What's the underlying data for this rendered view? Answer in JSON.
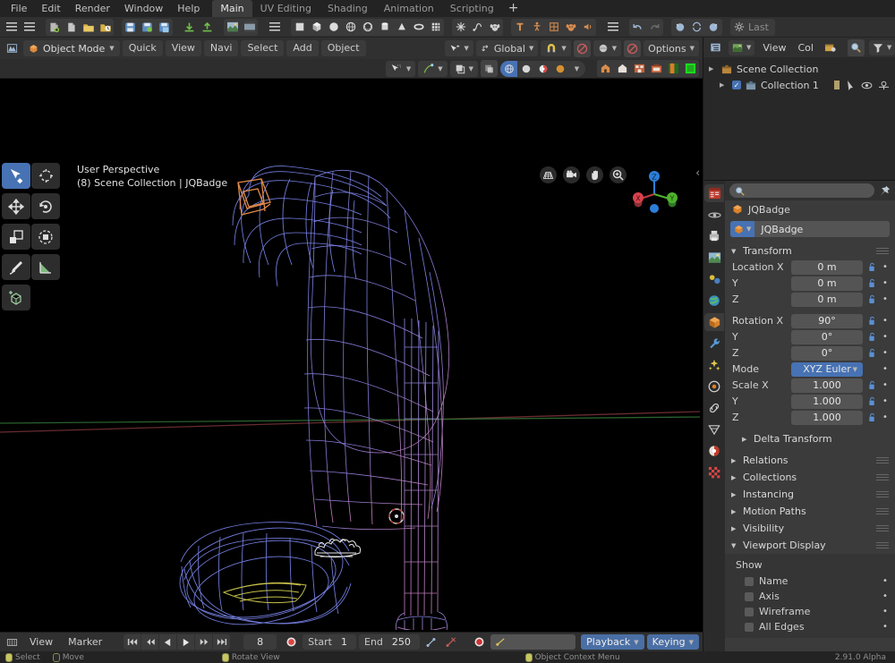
{
  "app": {
    "version": "2.91.0 Alpha"
  },
  "topbar": {
    "menus": [
      "File",
      "Edit",
      "Render",
      "Window",
      "Help"
    ],
    "workspaces": [
      {
        "label": "Main",
        "active": true
      },
      {
        "label": "UV Editing",
        "active": false
      },
      {
        "label": "Shading",
        "active": false
      },
      {
        "label": "Animation",
        "active": false
      },
      {
        "label": "Scripting",
        "active": false
      }
    ],
    "add_workspace": "+"
  },
  "toolbar": {
    "icons": [
      "hamburger-menu-icon",
      "editor-type-icon",
      "new-file-icon",
      "blank-file-icon",
      "open-folder-icon",
      "recent-folder-icon",
      "save-file-icon",
      "save-as-icon",
      "save-copy-icon",
      "import-icon",
      "export-icon",
      "render-image-icon",
      "render-animation-icon"
    ],
    "primitive_icons": [
      "plane-icon",
      "cube-icon",
      "sphere-icon",
      "uvsphere-icon",
      "icosphere-icon",
      "cylinder-icon",
      "cone-icon",
      "torus-icon",
      "grid-icon"
    ],
    "extra_icons": [
      "empty-axis-icon",
      "curve-icon",
      "monkey-icon"
    ],
    "orange_icons": [
      "text-icon",
      "armature-icon",
      "lattice-icon",
      "monkey-head-icon",
      "speaker-icon"
    ],
    "undo_label": "undo-icon",
    "redo_label": "redo-icon",
    "last_label": "Last"
  },
  "viewport_header": {
    "mode": "Object Mode",
    "menus": [
      "Quick",
      "View",
      "Navi",
      "Select",
      "Add",
      "Object"
    ],
    "transform_orientation": "Global",
    "snap_icon": "magnet-icon",
    "proportional_icon": "proportional-editing-icon",
    "options_label": "Options",
    "select_mode_icon": "tweak-select-icon",
    "shading_modes": [
      "wireframe",
      "solid",
      "material-preview",
      "rendered"
    ],
    "overlay_toggles": [
      "show-gizmo-icon",
      "show-overlays-icon",
      "xray-toggle-icon",
      "viewport-shading-icon"
    ]
  },
  "viewport": {
    "perspective_label": "User Perspective",
    "scene_label": "(8) Scene Collection | JQBadge",
    "tools": [
      "tweak-tool",
      "cursor-tool",
      "move-tool",
      "rotate-tool",
      "scale-tool",
      "transform-tool",
      "annotate-tool",
      "measure-tool",
      "add-cube-tool"
    ],
    "nav_icons": [
      "toggle-camera-grid-icon",
      "camera-view-icon",
      "pan-view-icon",
      "zoom-view-icon"
    ],
    "gizmo_axes": [
      {
        "label": "X",
        "color": "#d9434e"
      },
      {
        "label": "Y",
        "color": "#4eb32c"
      },
      {
        "label": "Z",
        "color": "#2c7fd9"
      }
    ],
    "wire_colors": {
      "mesh_blue": "#6a78e8",
      "mesh_pink": "#d07fb8",
      "selected_orange": "#e08a4a",
      "sole_yellow": "#c5c04a",
      "x_axis": "#7a2f35",
      "y_axis": "#2f6b33"
    }
  },
  "outliner": {
    "header_items": [
      "editor-type-icon",
      "display-mode-icon",
      "View",
      "Col",
      "new-collection-icon",
      "filter-search-icon",
      "filter-icon"
    ],
    "rows": [
      {
        "label": "Scene Collection",
        "indent": 0,
        "checkbox": false
      },
      {
        "label": "Collection 1",
        "indent": 1,
        "checkbox": true
      }
    ]
  },
  "properties": {
    "tabs": [
      "tool-tab",
      "render-tab",
      "output-tab",
      "view-layer-tab",
      "scene-tab",
      "world-tab",
      "object-tab",
      "modifier-tab",
      "particles-tab",
      "physics-tab",
      "constraints-tab",
      "data-tab",
      "material-tab",
      "texture-tab"
    ],
    "active_tab": "object-tab",
    "search_placeholder": "",
    "breadcrumb": "JQBadge",
    "object_name": "JQBadge",
    "transform": {
      "title": "Transform",
      "rows": [
        {
          "key": "Location X",
          "value": "0 m"
        },
        {
          "key": "Y",
          "value": "0 m"
        },
        {
          "key": "Z",
          "value": "0 m"
        },
        {
          "key": "Rotation X",
          "value": "90°"
        },
        {
          "key": "Y",
          "value": "0°"
        },
        {
          "key": "Z",
          "value": "0°"
        }
      ],
      "mode_key": "Mode",
      "mode_value": "XYZ Euler",
      "scale_rows": [
        {
          "key": "Scale X",
          "value": "1.000"
        },
        {
          "key": "Y",
          "value": "1.000"
        },
        {
          "key": "Z",
          "value": "1.000"
        }
      ],
      "delta_label": "Delta Transform"
    },
    "panels": [
      {
        "label": "Relations",
        "open": false
      },
      {
        "label": "Collections",
        "open": false
      },
      {
        "label": "Instancing",
        "open": false
      },
      {
        "label": "Motion Paths",
        "open": false
      },
      {
        "label": "Visibility",
        "open": false
      },
      {
        "label": "Viewport Display",
        "open": true
      }
    ],
    "viewport_display": {
      "show_label": "Show",
      "checkboxes": [
        {
          "label": "Name",
          "checked": false
        },
        {
          "label": "Axis",
          "checked": false
        },
        {
          "label": "Wireframe",
          "checked": false
        },
        {
          "label": "All Edges",
          "checked": false
        }
      ]
    }
  },
  "timeline": {
    "menus": [
      "View",
      "Marker"
    ],
    "transport": [
      "jump-start-icon",
      "prev-keyframe-icon",
      "play-reverse-icon",
      "play-icon",
      "next-keyframe-icon",
      "jump-end-icon"
    ],
    "current_frame": "8",
    "start_label": "Start",
    "start_value": "1",
    "end_label": "End",
    "end_value": "250",
    "autokey_icon": "record-icon",
    "keying_set_placeholder": "",
    "playback_label": "Playback",
    "keying_label": "Keying"
  },
  "status": {
    "hints": [
      {
        "label": "Select",
        "mouse": "left"
      },
      {
        "label": "Move",
        "mouse": "middle"
      },
      {
        "label": "Rotate View",
        "mouse": "middle"
      },
      {
        "label": "Object Context Menu",
        "mouse": "right"
      }
    ]
  }
}
